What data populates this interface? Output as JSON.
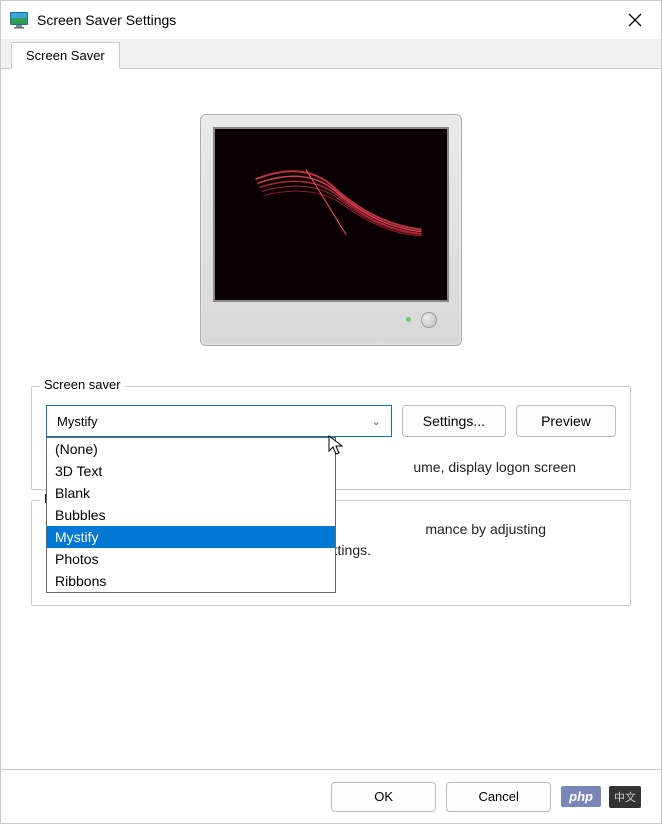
{
  "window": {
    "title": "Screen Saver Settings"
  },
  "tabs": {
    "main": "Screen Saver"
  },
  "screensaver": {
    "group_label": "Screen saver",
    "selected": "Mystify",
    "settings_btn": "Settings...",
    "preview_btn": "Preview",
    "options": {
      "o0": "(None)",
      "o1": "3D Text",
      "o2": "Blank",
      "o3": "Bubbles",
      "o4": "Mystify",
      "o5": "Photos",
      "o6": "Ribbons"
    },
    "resume_text_fragment": "ume, display logon screen"
  },
  "power": {
    "label_prefix": "P",
    "line1_fragment": "mance by adjusting",
    "line2_fragment": "settings.",
    "link": "Change power settings"
  },
  "buttons": {
    "ok": "OK",
    "cancel": "Cancel"
  },
  "badge": {
    "php": "php",
    "cn": "中文"
  }
}
